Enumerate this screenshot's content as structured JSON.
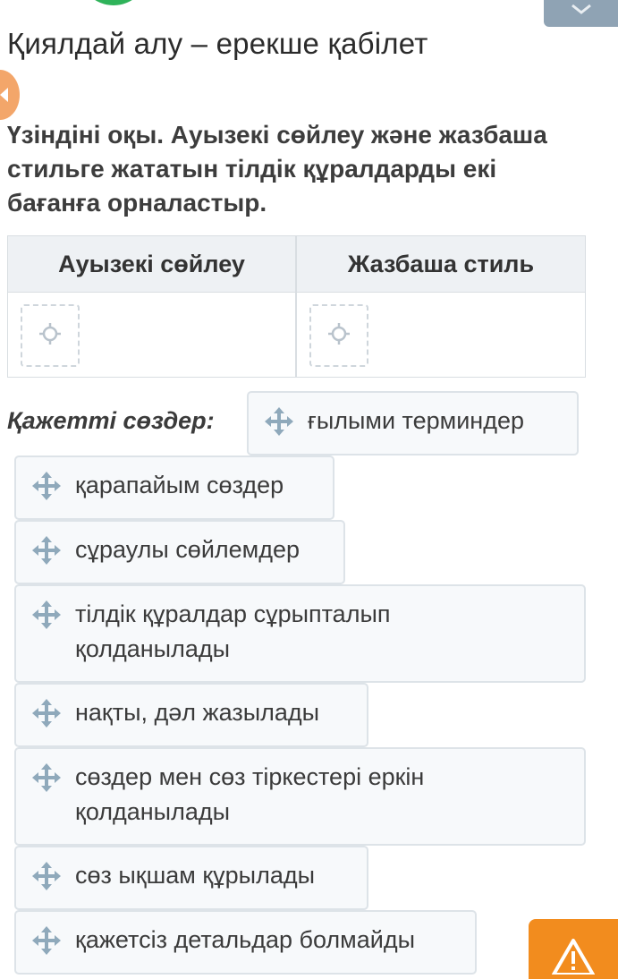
{
  "title": "Қиялдай алу – ерекше қабілет",
  "instruction": "Үзіндіні оқы. Ауызекі сөйлеу және жазбаша стильге жататын тілдік құралдарды екі бағанға орналастыр.",
  "table": {
    "columns": [
      "Ауызекі сөйлеу",
      "Жазбаша стиль"
    ]
  },
  "needed_words_label": "Қажетті сөздер:",
  "options": [
    {
      "label": "ғылыми терминдер"
    },
    {
      "label": "қарапайым сөздер"
    },
    {
      "label": "сұраулы сөйлемдер"
    },
    {
      "label": "тілдік құралдар сұрыпталып қолданылады"
    },
    {
      "label": "нақты, дәл жазылады"
    },
    {
      "label": "сөздер мен сөз тіркестері еркін қолданылады"
    },
    {
      "label": "сөз ықшам құрылады"
    },
    {
      "label": "қажетсіз детальдар болмайды"
    }
  ],
  "colors": {
    "accent_green": "#2fb35a",
    "warning_orange": "#f28c1e",
    "chip_border": "#dde3e8",
    "icon_blue_gray": "#8fa9bb"
  },
  "icons": {
    "drag": "move-arrows-icon",
    "drop_target": "crosshair-icon",
    "warning": "warning-triangle-icon"
  }
}
